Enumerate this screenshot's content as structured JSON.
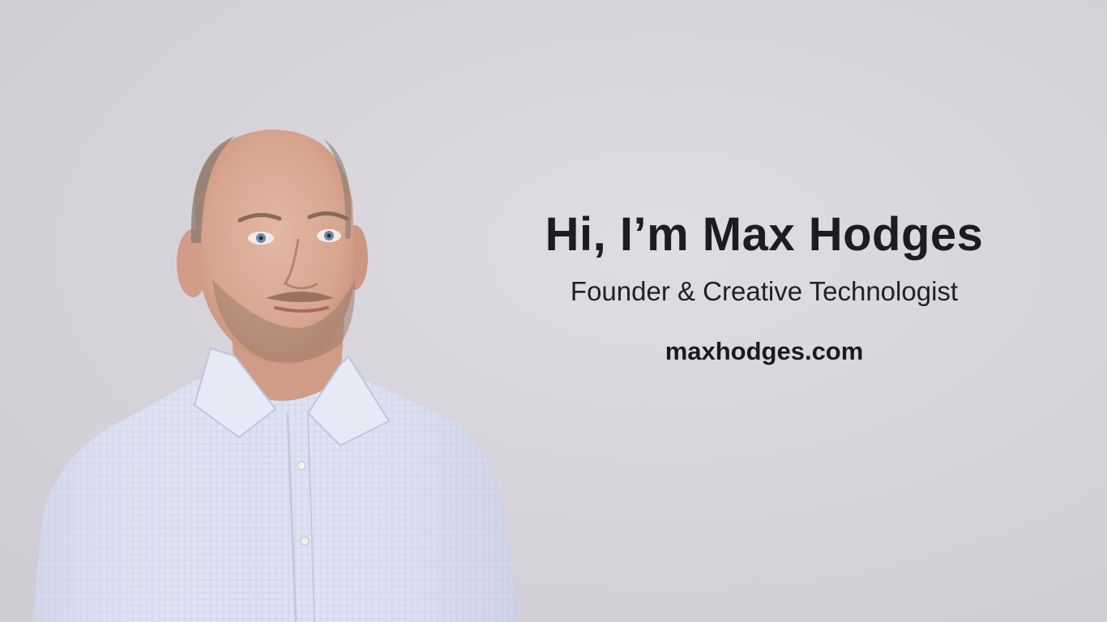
{
  "profile": {
    "headline": "Hi, I’m Max Hodges",
    "tagline": "Founder & Creative Technologist",
    "website": "maxhodges.com"
  },
  "photo": {
    "subject": "portrait-photo"
  },
  "colors": {
    "background": "#d8d4dc",
    "text": "#1e1c20",
    "shirt": "#dfe3f3"
  }
}
